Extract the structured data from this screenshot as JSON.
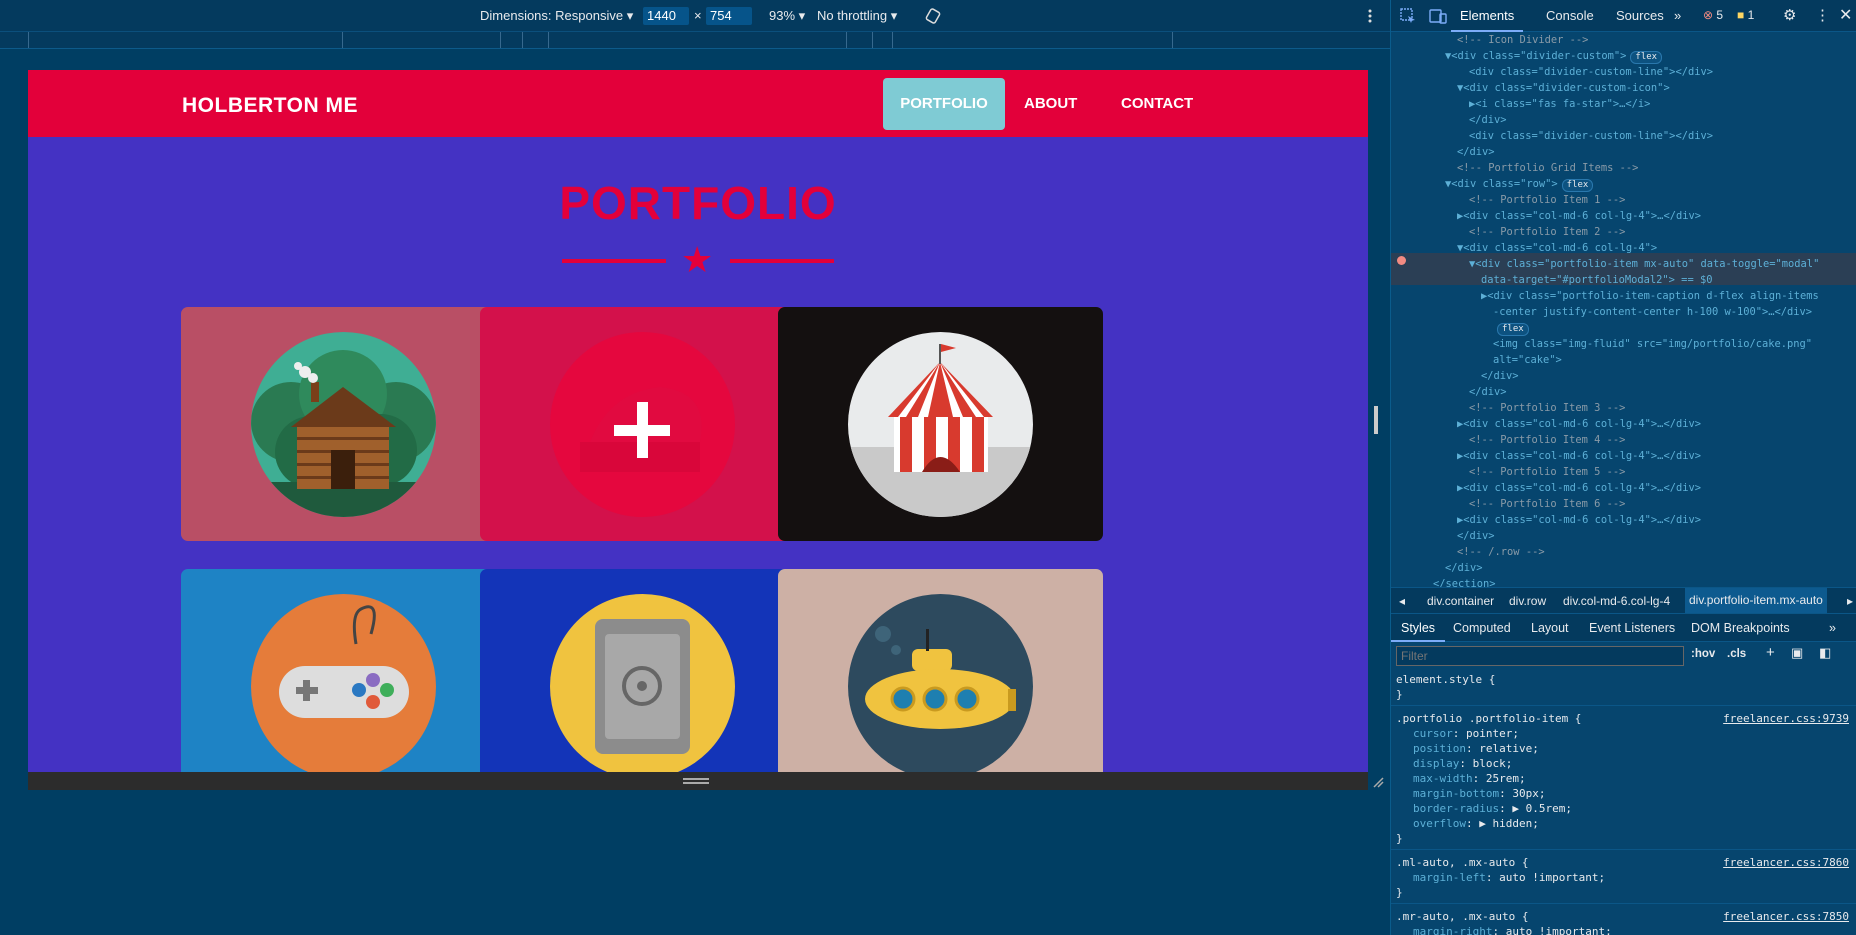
{
  "device_toolbar": {
    "dimensions_label": "Dimensions: Responsive",
    "width": "1440",
    "times": "×",
    "height": "754",
    "zoom": "93%",
    "throttling": "No throttling"
  },
  "site": {
    "brand": "HOLBERTON ME",
    "nav": [
      "PORTFOLIO",
      "ABOUT",
      "CONTACT"
    ],
    "section_title": "PORTFOLIO",
    "divider_icon": "star-icon",
    "cards": [
      {
        "name": "cabin",
        "color": "#b94f65"
      },
      {
        "name": "cake",
        "color": "#d3114b",
        "hover_icon": "plus-icon"
      },
      {
        "name": "circus",
        "color": "#141010"
      },
      {
        "name": "game",
        "color": "#1e83c5"
      },
      {
        "name": "safe",
        "color": "#1334b8"
      },
      {
        "name": "submarine",
        "color": "#cdb0a5"
      }
    ],
    "colors": {
      "primary": "#e3003a",
      "background": "#4432c3",
      "active_nav": "#7fcbd4"
    }
  },
  "devtools": {
    "tabs": [
      "Elements",
      "Console",
      "Sources"
    ],
    "errors": "5",
    "warnings": "1",
    "dom": [
      {
        "indent": 5,
        "text": "<!-- Icon Divider -->",
        "kind": "comment"
      },
      {
        "indent": 4,
        "text": "▼<div class=\"divider-custom\">",
        "pill": "flex"
      },
      {
        "indent": 6,
        "text": "<div class=\"divider-custom-line\"></div>"
      },
      {
        "indent": 5,
        "text": "▼<div class=\"divider-custom-icon\">"
      },
      {
        "indent": 6,
        "text": "▶<i class=\"fas fa-star\">…</i>"
      },
      {
        "indent": 6,
        "text": "</div>"
      },
      {
        "indent": 6,
        "text": "<div class=\"divider-custom-line\"></div>"
      },
      {
        "indent": 5,
        "text": "</div>"
      },
      {
        "indent": 5,
        "text": "<!-- Portfolio Grid Items -->",
        "kind": "comment"
      },
      {
        "indent": 4,
        "text": "▼<div class=\"row\">",
        "pill": "flex"
      },
      {
        "indent": 6,
        "text": "<!-- Portfolio Item 1 -->",
        "kind": "comment"
      },
      {
        "indent": 5,
        "text": "▶<div class=\"col-md-6 col-lg-4\">…</div>"
      },
      {
        "indent": 6,
        "text": "<!-- Portfolio Item 2 -->",
        "kind": "comment"
      },
      {
        "indent": 5,
        "text": "▼<div class=\"col-md-6 col-lg-4\">"
      },
      {
        "indent": 6,
        "text": "▼<div class=\"portfolio-item mx-auto\" data-toggle=\"modal\"",
        "selected": true
      },
      {
        "indent": 7,
        "text": "data-target=\"#portfolioModal2\"> == $0",
        "selected": true
      },
      {
        "indent": 7,
        "text": "▶<div class=\"portfolio-item-caption d-flex align-items"
      },
      {
        "indent": 8,
        "text": "-center justify-content-center h-100 w-100\">…</div>"
      },
      {
        "indent": 8,
        "text": "",
        "pill": "flex"
      },
      {
        "indent": 8,
        "text": "<img class=\"img-fluid\" src=\"img/portfolio/cake.png\""
      },
      {
        "indent": 8,
        "text": "alt=\"cake\">"
      },
      {
        "indent": 7,
        "text": "</div>"
      },
      {
        "indent": 6,
        "text": "</div>"
      },
      {
        "indent": 6,
        "text": "<!-- Portfolio Item 3 -->",
        "kind": "comment"
      },
      {
        "indent": 5,
        "text": "▶<div class=\"col-md-6 col-lg-4\">…</div>"
      },
      {
        "indent": 6,
        "text": "<!-- Portfolio Item 4 -->",
        "kind": "comment"
      },
      {
        "indent": 5,
        "text": "▶<div class=\"col-md-6 col-lg-4\">…</div>"
      },
      {
        "indent": 6,
        "text": "<!-- Portfolio Item 5 -->",
        "kind": "comment"
      },
      {
        "indent": 5,
        "text": "▶<div class=\"col-md-6 col-lg-4\">…</div>"
      },
      {
        "indent": 6,
        "text": "<!-- Portfolio Item 6 -->",
        "kind": "comment"
      },
      {
        "indent": 5,
        "text": "▶<div class=\"col-md-6 col-lg-4\">…</div>"
      },
      {
        "indent": 5,
        "text": "</div>"
      },
      {
        "indent": 5,
        "text": "<!-- /.row -->",
        "kind": "comment"
      },
      {
        "indent": 4,
        "text": "</div>"
      },
      {
        "indent": 3,
        "text": "</section>"
      }
    ],
    "breadcrumb": [
      "div.container",
      "div.row",
      "div.col-md-6.col-lg-4",
      "div.portfolio-item.mx-auto"
    ],
    "style_tabs": [
      "Styles",
      "Computed",
      "Layout",
      "Event Listeners",
      "DOM Breakpoints"
    ],
    "filter_placeholder": "Filter",
    "hov": ":hov",
    "cls": ".cls",
    "rules": [
      {
        "selector": "element.style {",
        "source": "",
        "props": [],
        "close": "}"
      },
      {
        "selector": ".portfolio .portfolio-item {",
        "source": "freelancer.css:9739",
        "props": [
          [
            "cursor",
            "pointer;"
          ],
          [
            "position",
            "relative;"
          ],
          [
            "display",
            "block;"
          ],
          [
            "max-width",
            "25rem;"
          ],
          [
            "margin-bottom",
            "30px;"
          ],
          [
            "border-radius",
            "▶ 0.5rem;"
          ],
          [
            "overflow",
            "▶ hidden;"
          ]
        ],
        "close": "}"
      },
      {
        "selector": ".ml-auto, .mx-auto {",
        "source": "freelancer.css:7860",
        "props": [
          [
            "margin-left",
            "auto !important;"
          ]
        ],
        "close": "}"
      },
      {
        "selector": ".mr-auto, .mx-auto {",
        "source": "freelancer.css:7850",
        "props": [
          [
            "margin-right",
            "auto !important;"
          ]
        ],
        "close": ""
      }
    ]
  }
}
